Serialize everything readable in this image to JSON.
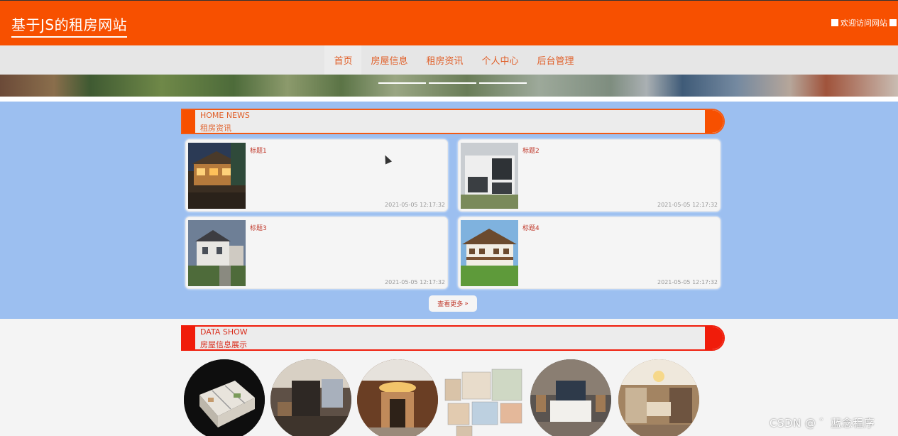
{
  "header": {
    "site_title": "基于JS的租房网站",
    "welcome_text": "欢迎访问网站",
    "brand_color": "#f75000"
  },
  "nav": {
    "items": [
      {
        "label": "首页",
        "active": true
      },
      {
        "label": "房屋信息",
        "active": false
      },
      {
        "label": "租房资讯",
        "active": false
      },
      {
        "label": "个人中心",
        "active": false
      },
      {
        "label": "后台管理",
        "active": false
      }
    ]
  },
  "news_section": {
    "title_en": "HOME NEWS",
    "title_cn": "租房资讯",
    "items": [
      {
        "title": "标题1",
        "time": "2021-05-05 12:17:32",
        "image": "house-photo-night"
      },
      {
        "title": "标题2",
        "time": "2021-05-05 12:17:32",
        "image": "house-photo-modern"
      },
      {
        "title": "标题3",
        "time": "2021-05-05 12:17:32",
        "image": "house-photo-suburban"
      },
      {
        "title": "标题4",
        "time": "2021-05-05 12:17:32",
        "image": "house-photo-chalet"
      }
    ],
    "more_label": "查看更多",
    "more_icon": "double-chevron-right-icon"
  },
  "data_section": {
    "title_en": "DATA SHOW",
    "title_cn": "房屋信息展示",
    "images": [
      "floorplan-3d",
      "interior-bedroom-dark",
      "interior-lobby",
      "interior-sketch",
      "interior-hotel-bedroom",
      "interior-dining"
    ]
  },
  "watermark": "CSDN @ ゛蓝念程序"
}
